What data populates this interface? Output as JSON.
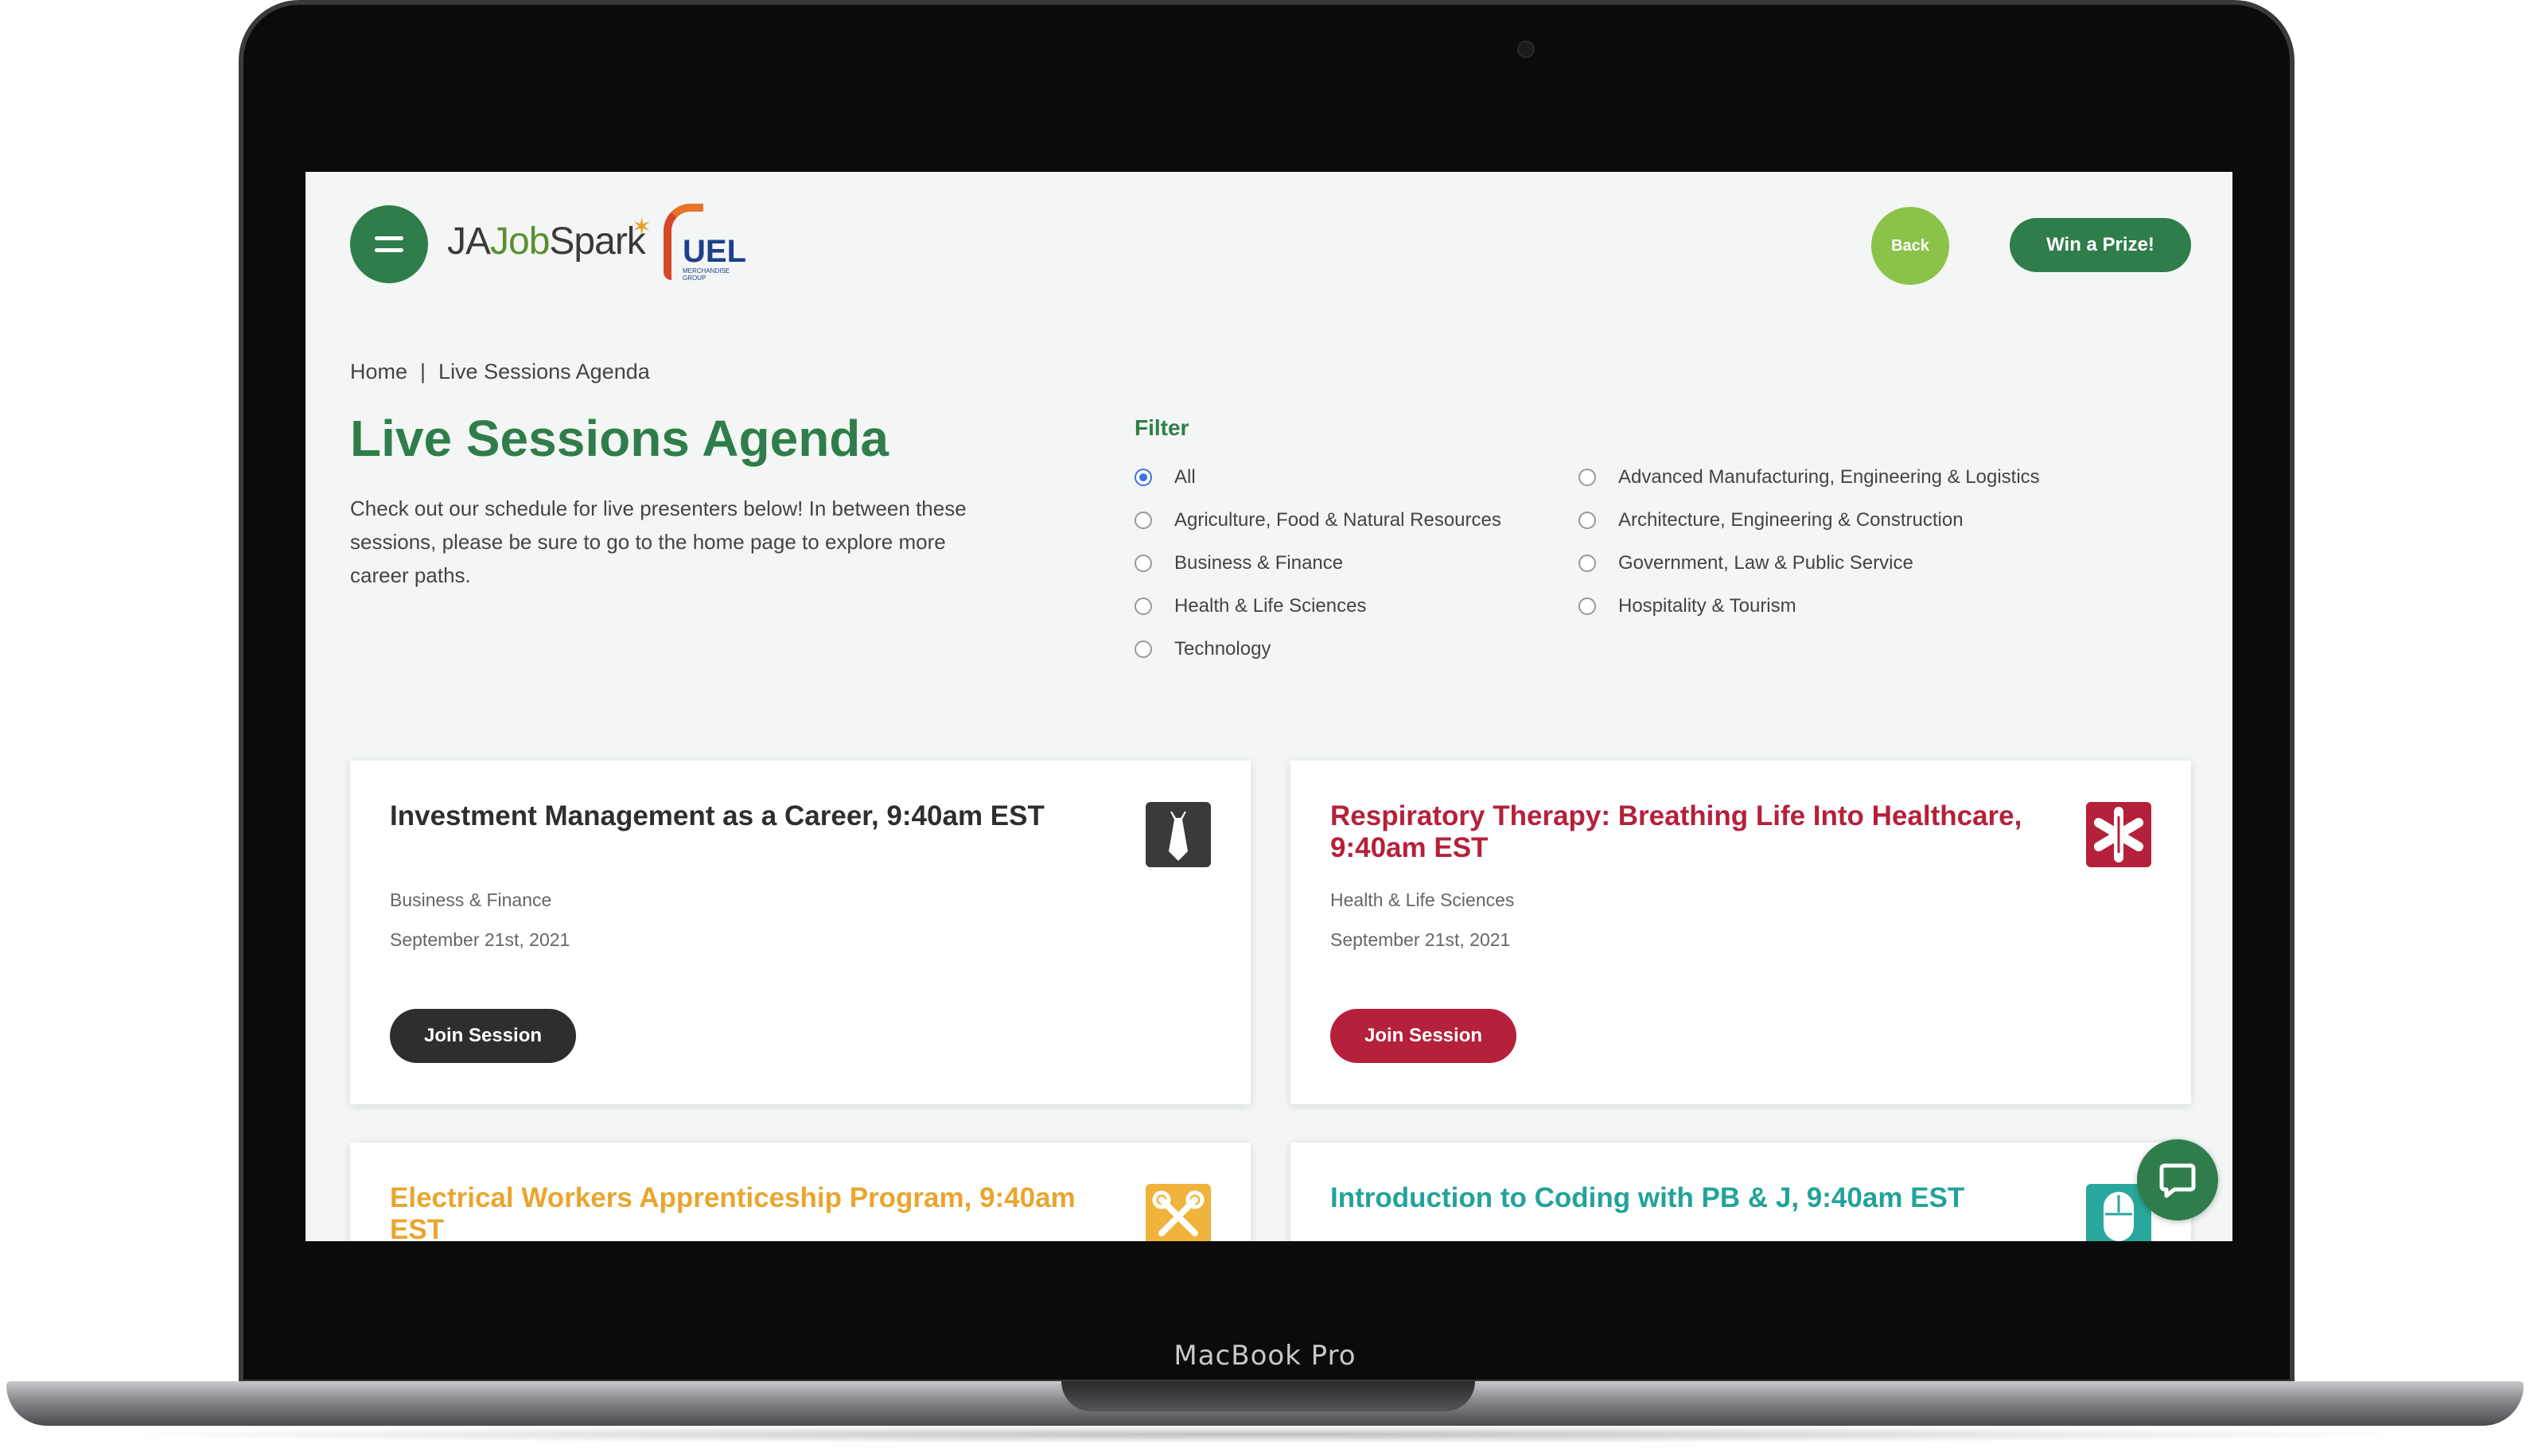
{
  "device": {
    "brand": "MacBook Pro"
  },
  "header": {
    "logo_prefix": "JA",
    "logo_job": "Job",
    "logo_spark": "Spark",
    "partner_logo": "UEL",
    "partner_tagline": "MERCHANDISE GROUP",
    "back_label": "Back",
    "prize_label": "Win a Prize!"
  },
  "breadcrumb": {
    "home": "Home",
    "separator": "|",
    "current": "Live Sessions Agenda"
  },
  "page": {
    "title": "Live Sessions Agenda",
    "intro": "Check out our schedule for live presenters below! In between these sessions, please be sure to go to the home page to explore more career paths."
  },
  "filter": {
    "label": "Filter",
    "selected": "All",
    "options": [
      "All",
      "Agriculture, Food & Natural Resources",
      "Business & Finance",
      "Health & Life Sciences",
      "Technology",
      "Advanced Manufacturing, Engineering & Logistics",
      "Architecture, Engineering & Construction",
      "Government, Law & Public Service",
      "Hospitality & Tourism"
    ]
  },
  "sessions": [
    {
      "title": "Investment Management as a Career, 9:40am EST",
      "category": "Business & Finance",
      "date": "September 21st, 2021",
      "button": "Join Session",
      "icon": "tie-icon",
      "color": "#2e2e2e"
    },
    {
      "title": "Respiratory Therapy: Breathing Life Into Healthcare, 9:40am EST",
      "category": "Health & Life Sciences",
      "date": "September 21st, 2021",
      "button": "Join Session",
      "icon": "medical-star-icon",
      "color": "#b5203a"
    },
    {
      "title": "Electrical Workers Apprenticeship Program, 9:40am EST",
      "icon": "tools-icon",
      "color": "#e8a630"
    },
    {
      "title": "Introduction to Coding with PB & J, 9:40am EST",
      "icon": "mouse-icon",
      "color": "#22a39a"
    }
  ],
  "colors": {
    "primary": "#2f7d4b",
    "back": "#8bc34a",
    "page_bg": "#f3f6f4"
  }
}
